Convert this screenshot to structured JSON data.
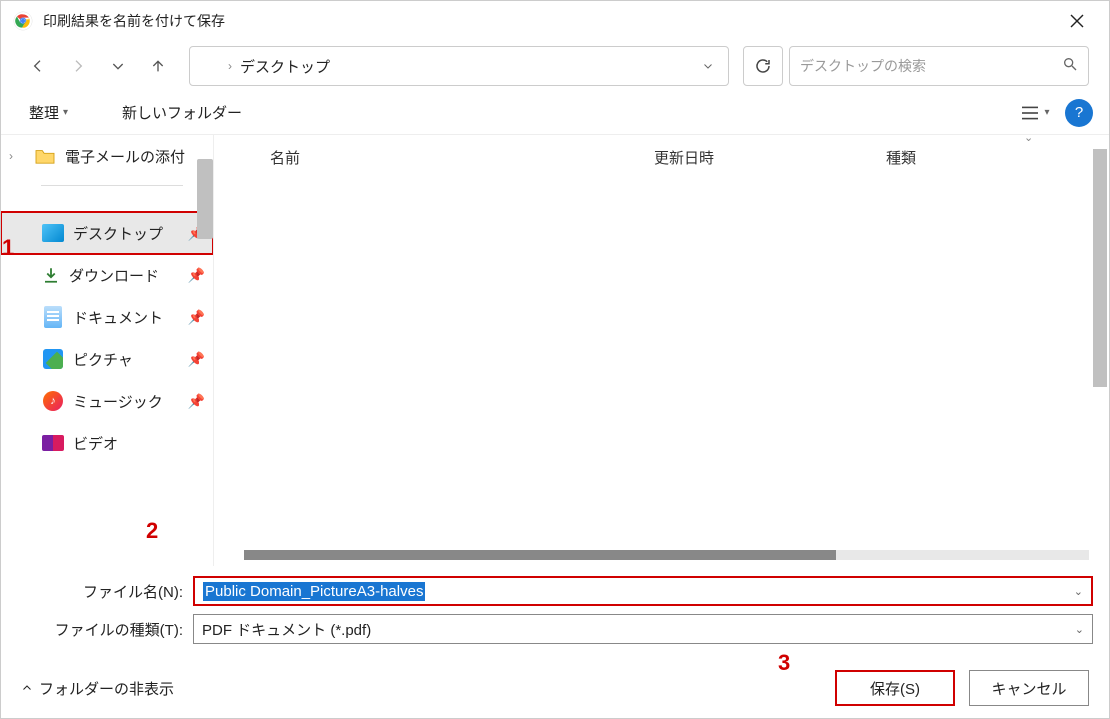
{
  "title": "印刷結果を名前を付けて保存",
  "breadcrumb": {
    "location": "デスクトップ"
  },
  "search": {
    "placeholder": "デスクトップの検索"
  },
  "toolbar": {
    "organize": "整理",
    "new_folder": "新しいフォルダー"
  },
  "sidebar": {
    "email_attachments": "電子メールの添付",
    "items": [
      {
        "label": "デスクトップ"
      },
      {
        "label": "ダウンロード"
      },
      {
        "label": "ドキュメント"
      },
      {
        "label": "ピクチャ"
      },
      {
        "label": "ミュージック"
      },
      {
        "label": "ビデオ"
      }
    ]
  },
  "columns": {
    "name": "名前",
    "date": "更新日時",
    "type": "種類"
  },
  "filename": {
    "label": "ファイル名(N):",
    "value": "Public Domain_PictureA3-halves"
  },
  "filetype": {
    "label": "ファイルの種類(T):",
    "value": "PDF ドキュメント (*.pdf)"
  },
  "footer": {
    "hide_folders": "フォルダーの非表示",
    "save": "保存(S)",
    "cancel": "キャンセル"
  },
  "annotations": {
    "n1": "1",
    "n2": "2",
    "n3": "3"
  }
}
